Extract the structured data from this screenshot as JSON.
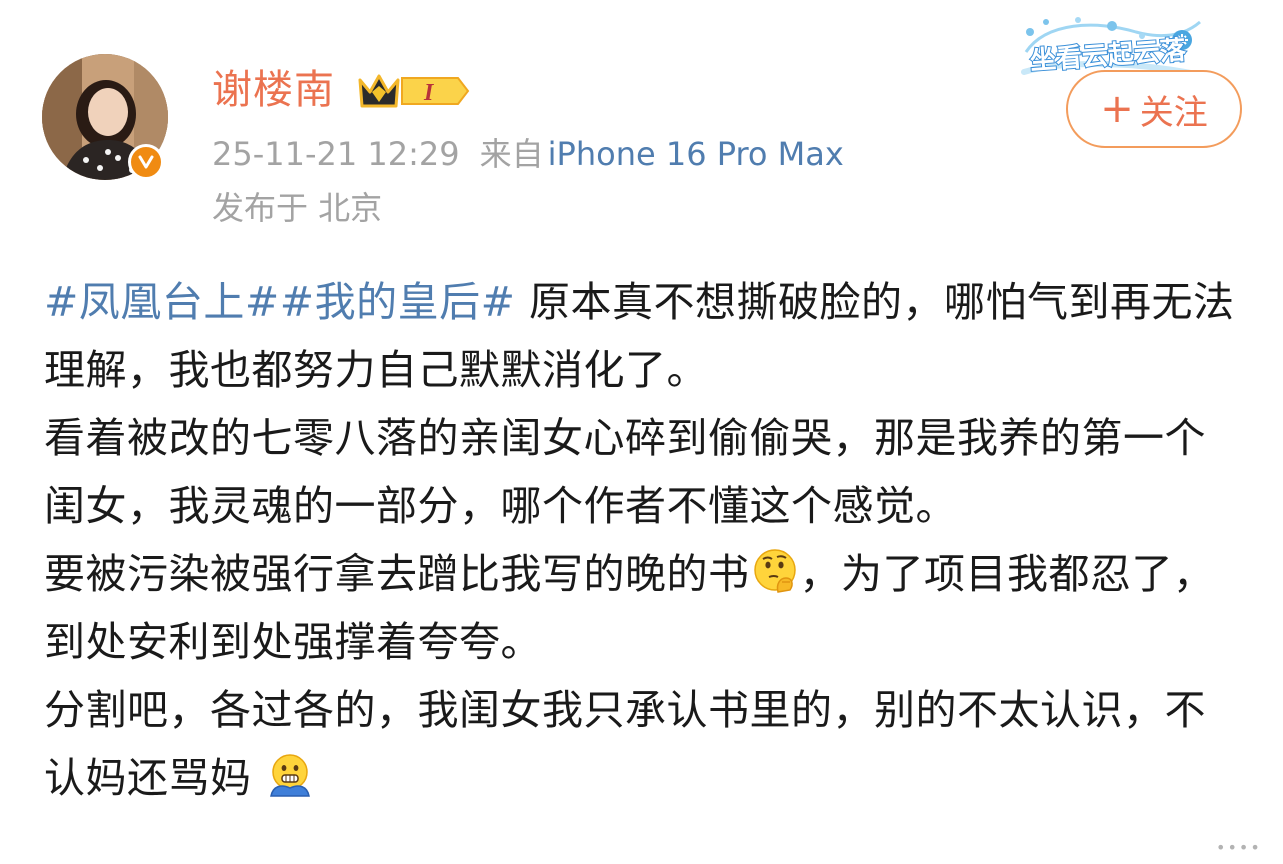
{
  "header": {
    "username": "谢楼南",
    "vip_level": "I",
    "timestamp": "25-11-21 12:29",
    "source_prefix": "来自",
    "device": "iPhone 16 Pro Max",
    "location": "发布于 北京",
    "decoration_text": "坐看云起云落",
    "follow_label": "关注"
  },
  "post": {
    "paragraphs": [
      {
        "hashtag1": "#凤凰台上#",
        "hashtag2": "#我的皇后#",
        "text": " 原本真不想撕破脸的，哪怕气到再无法理解，我也都努力自己默默消化了。"
      },
      {
        "text": "看着被改的七零八落的亲闺女心碎到偷偷哭，那是我养的第一个闺女，我灵魂的一部分，哪个作者不懂这个感觉。"
      },
      {
        "text_before_emoji": "要被污染被强行拿去蹭比我写的晚的书",
        "emoji": "thinking-face-icon",
        "text_after_emoji": "，为了项目我都忍了，到处安利到处强撑着夸夸。"
      },
      {
        "text": "分割吧，各过各的，我闺女我只承认书里的，别的不太认识，不认妈还骂妈",
        "emoji": "cold-face-icon"
      }
    ]
  },
  "colors": {
    "username": "#eb7350",
    "hashtag": "#507daf",
    "meta": "#a3a3a3",
    "follow_border": "#f39c5c",
    "verified_badge": "#f08b12"
  }
}
